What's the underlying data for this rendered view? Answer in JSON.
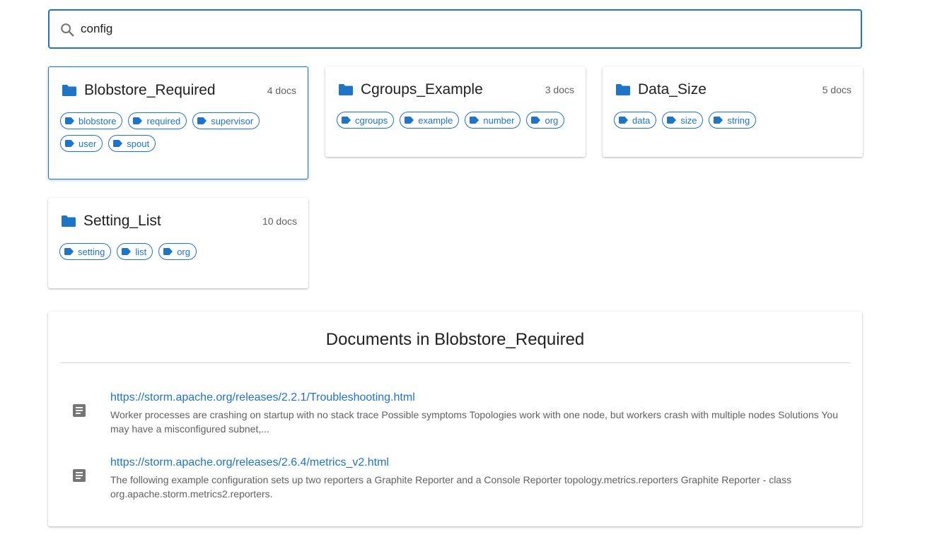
{
  "search": {
    "value": "config",
    "placeholder": ""
  },
  "collections": [
    {
      "title": "Blobstore_Required",
      "count": "4 docs",
      "selected": true,
      "tags": [
        "blobstore",
        "required",
        "supervisor",
        "user",
        "spout"
      ]
    },
    {
      "title": "Cgroups_Example",
      "count": "3 docs",
      "selected": false,
      "tags": [
        "cgroups",
        "example",
        "number",
        "org"
      ]
    },
    {
      "title": "Data_Size",
      "count": "5 docs",
      "selected": false,
      "tags": [
        "data",
        "size",
        "string"
      ]
    },
    {
      "title": "Setting_List",
      "count": "10 docs",
      "selected": false,
      "tags": [
        "setting",
        "list",
        "org"
      ]
    }
  ],
  "documents": {
    "title": "Documents in Blobstore_Required",
    "items": [
      {
        "url": "https://storm.apache.org/releases/2.2.1/Troubleshooting.html",
        "snippet": "Worker processes are crashing on startup with no stack trace Possible symptoms Topologies work with one node, but workers crash with multiple nodes Solutions You may have a misconfigured subnet,..."
      },
      {
        "url": "https://storm.apache.org/releases/2.6.4/metrics_v2.html",
        "snippet": "The following example configuration sets up two reporters a Graphite Reporter and a Console Reporter topology.metrics.reporters Graphite Reporter - class org.apache.storm.metrics2.reporters."
      }
    ]
  },
  "colors": {
    "accent": "#1e74c6",
    "text": "#212121",
    "muted": "#616161",
    "icon_gray": "#757575"
  },
  "icons": {
    "search": "search-icon",
    "folder": "folder-icon",
    "tag": "tag-icon",
    "document": "document-icon"
  }
}
